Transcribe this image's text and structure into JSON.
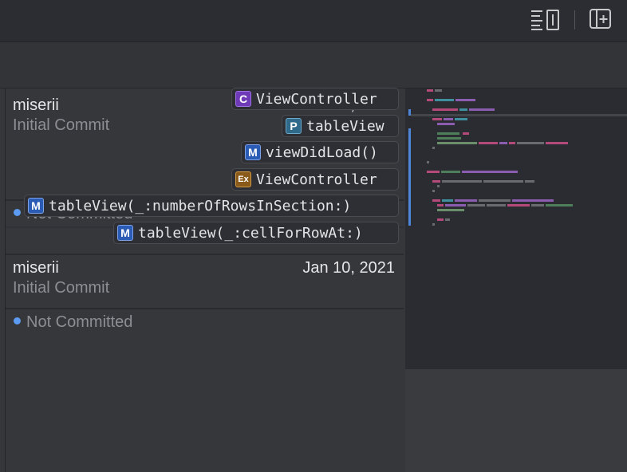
{
  "toolbar": {
    "icons": [
      "inspector-list-icon",
      "add-editor-icon"
    ]
  },
  "history": {
    "ghost_entry": {
      "author": "miserii",
      "message": "Initial Commit",
      "date": "Jan 10, 2021"
    },
    "ghost_status": "Not Committed",
    "entries": [
      {
        "author": "miserii",
        "message": "Initial Commit",
        "date": "Jan 10, 2021"
      }
    ],
    "status": "Not Committed"
  },
  "symbols": [
    {
      "kind": "C",
      "name": "ViewController"
    },
    {
      "kind": "P",
      "name": "tableView"
    },
    {
      "kind": "M",
      "name": "viewDidLoad()"
    },
    {
      "kind": "Ex",
      "name": "ViewController"
    },
    {
      "kind": "M",
      "name": "tableView(_:numberOfRowsInSection:)"
    },
    {
      "kind": "M",
      "name": "tableView(_:cellForRowAt:)"
    }
  ],
  "colors": {
    "accent": "#5b9bf2",
    "class_badge": "#6e3ab8",
    "property_badge": "#2f6a8a",
    "method_badge": "#2a5bb5",
    "extension_badge": "#8a5a1a"
  }
}
